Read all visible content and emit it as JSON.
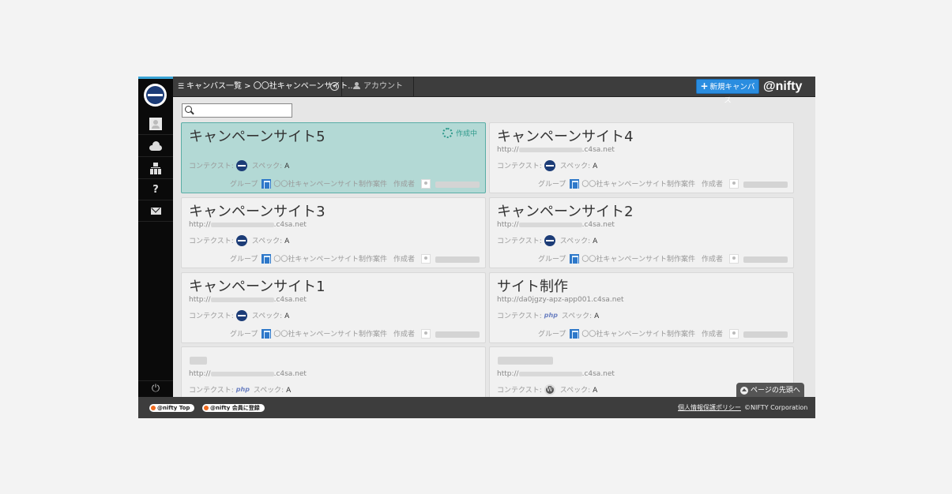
{
  "header": {
    "breadcrumb": "キャンバス一覧 > 〇〇社キャンペーンサイト...",
    "account_label": "アカウント",
    "new_canvas_label": "新規キャンバス",
    "brand": "@nifty"
  },
  "search": {
    "placeholder": ""
  },
  "labels": {
    "context": "コンテクスト:",
    "spec": "スペック:",
    "group": "グループ",
    "creator": "作成者",
    "url_prefix": "http://",
    "url_suffix": ".c4sa.net"
  },
  "cards": [
    {
      "title": "キャンペーンサイト5",
      "status": "作成中",
      "spec": "A",
      "context_icon": "globe-icon",
      "group": "〇〇社キャンペーンサイト制作案件",
      "active": true
    },
    {
      "title": "キャンペーンサイト4",
      "spec": "A",
      "context_icon": "globe-icon",
      "group": "〇〇社キャンペーンサイト制作案件"
    },
    {
      "title": "キャンペーンサイト3",
      "spec": "A",
      "context_icon": "globe-icon",
      "group": "〇〇社キャンペーンサイト制作案件"
    },
    {
      "title": "キャンペーンサイト2",
      "spec": "A",
      "context_icon": "globe-icon",
      "group": "〇〇社キャンペーンサイト制作案件"
    },
    {
      "title": "キャンペーンサイト1",
      "spec": "A",
      "context_icon": "globe-icon",
      "group": "〇〇社キャンペーンサイト制作案件"
    },
    {
      "title": "サイト制作",
      "url": "http://da0jgzy-apz-app001.c4sa.net",
      "spec": "A",
      "context_icon": "php-icon",
      "context_text": "php",
      "group": "〇〇社キャンペーンサイト制作案件"
    },
    {
      "spec": "A",
      "context_icon": "php-icon",
      "context_text": "php"
    },
    {
      "spec": "A",
      "context_icon": "wordpress-icon",
      "context_text": "W"
    }
  ],
  "back_to_top": "ページの先頭へ",
  "footer": {
    "badge1": "@nifty Top",
    "badge2": "@nifty 会員に登録",
    "privacy": "個人情報保護ポリシー",
    "copyright": "©NIFTY Corporation"
  },
  "sidebar": {
    "help_glyph": "?",
    "power_glyph": "⏻"
  },
  "colors": {
    "accent": "#2a8de0",
    "active_card": "#b3d9d5",
    "status": "#2f9a8c"
  }
}
